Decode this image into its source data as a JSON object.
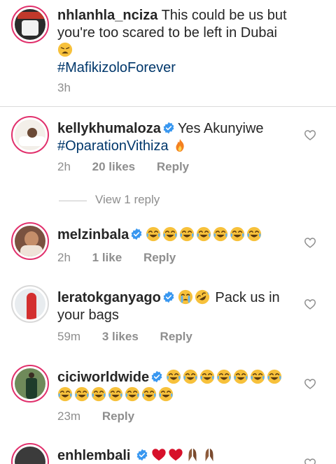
{
  "caption": {
    "username": "nhlanhla_nciza",
    "text": "This could be us but you're too scared to be left in Dubai",
    "hashtag": "#MafikizoloForever",
    "time": "3h"
  },
  "comments": [
    {
      "username": "kellykhumaloza",
      "text": "Yes Akunyiwe",
      "hashtag": "#OparationVithiza",
      "time": "2h",
      "likes": "20 likes",
      "reply": "Reply",
      "view_replies": "View 1 reply"
    },
    {
      "username": "melzinbala",
      "time": "2h",
      "likes": "1 like",
      "reply": "Reply",
      "emojis": [
        "joy-emoji",
        "joy-emoji",
        "joy-emoji",
        "joy-emoji",
        "joy-emoji",
        "joy-emoji",
        "joy-emoji"
      ]
    },
    {
      "username": "leratokganyago",
      "text": "Pack us in your bags",
      "time": "59m",
      "likes": "3 likes",
      "reply": "Reply",
      "emojis": [
        "crying-emoji",
        "rofl-emoji"
      ]
    },
    {
      "username": "ciciworldwide",
      "time": "23m",
      "reply": "Reply",
      "emojis": [
        "joy-emoji",
        "joy-emoji",
        "joy-emoji",
        "joy-emoji",
        "joy-emoji",
        "joy-emoji",
        "joy-emoji",
        "joy-emoji",
        "joy-emoji",
        "joy-emoji",
        "joy-emoji",
        "joy-emoji",
        "joy-emoji",
        "joy-emoji"
      ]
    },
    {
      "username": "enhlembali",
      "emojis": [
        "heart-emoji",
        "heart-emoji",
        "hands-emoji",
        "hands-emoji"
      ]
    }
  ],
  "colors": {
    "verified": "#3897f0",
    "hashtag": "#00376b",
    "meta": "#8e8e8e",
    "story_ring": "#e1306c"
  }
}
